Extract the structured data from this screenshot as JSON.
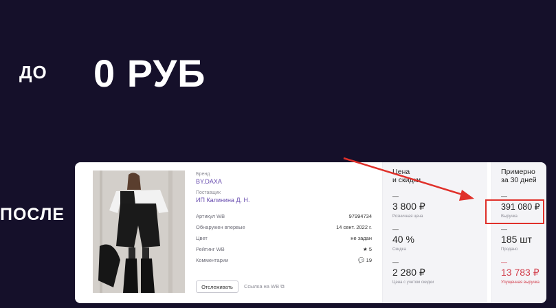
{
  "slide": {
    "before_label": "ДО",
    "before_value": "0 РУБ",
    "after_label": "ПОСЛЕ"
  },
  "product": {
    "brand_caption": "Бренд",
    "brand": "BY.DAXA",
    "supplier_caption": "Поставщик",
    "supplier": "ИП Калинина Д. Н.",
    "details": [
      {
        "label": "Артикул WB",
        "value": "97994734"
      },
      {
        "label": "Обнаружен впервые",
        "value": "14 сент. 2022 г."
      },
      {
        "label": "Цвет",
        "value": "не задан"
      },
      {
        "label": "Рейтинг WB",
        "value": "★  5"
      },
      {
        "label": "Комментарии",
        "value": "💬 19"
      }
    ],
    "track_button": "Отслеживать",
    "wb_link": "Ссылка на WB  ⧉"
  },
  "price": {
    "title": "Цена\nи скидки",
    "retail": "3 800 ₽",
    "retail_caption": "Розничная цена",
    "discount": "40 %",
    "discount_caption": "Скидка",
    "final": "2 280 ₽",
    "final_caption": "Цена с учетом скидки"
  },
  "stats": {
    "title": "Примерно\nза 30 дней",
    "revenue": "391 080 ₽",
    "revenue_caption": "Выручка",
    "sold": "185 шт",
    "sold_caption": "Продано",
    "lost": "13 783 ₽",
    "lost_caption": "Упущенная выручка"
  },
  "colors": {
    "background": "#15102a",
    "accent_red": "#e0302a",
    "link": "#6a4fb0"
  }
}
